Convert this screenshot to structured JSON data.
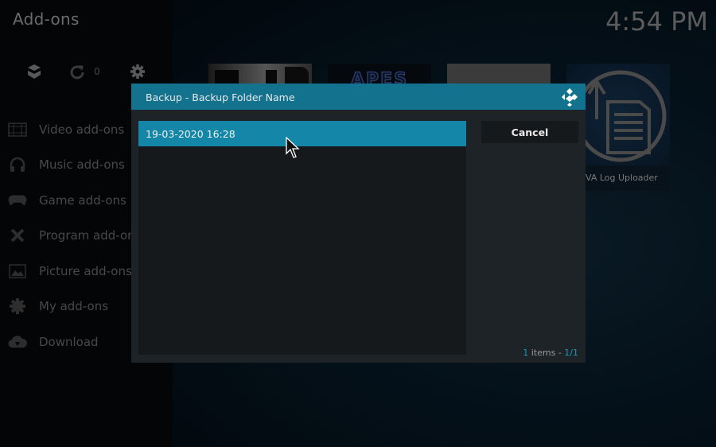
{
  "window": {
    "title": "Add-ons",
    "clock": "4:54 PM"
  },
  "toolbar": {
    "icons": [
      "box-icon",
      "refresh-icon",
      "gear-icon"
    ],
    "update_count": "0"
  },
  "sidebar": {
    "items": [
      {
        "label": "Video add-ons",
        "icon": "film-icon"
      },
      {
        "label": "Music add-ons",
        "icon": "headphones-icon"
      },
      {
        "label": "Game add-ons",
        "icon": "gamepad-icon"
      },
      {
        "label": "Program add-ons",
        "icon": "tools-icon"
      },
      {
        "label": "Picture add-ons",
        "icon": "picture-icon"
      },
      {
        "label": "My add-ons",
        "icon": "gear-wrench-icon"
      },
      {
        "label": "Download",
        "icon": "cloud-download-icon"
      }
    ]
  },
  "background_tiles": [
    {
      "label": ""
    },
    {
      "label": "APES"
    },
    {
      "label": ""
    },
    {
      "label": "VA Log Uploader"
    }
  ],
  "dialog": {
    "title": "Backup - Backup Folder Name",
    "items": [
      {
        "label": "19-03-2020 16:28",
        "selected": true
      }
    ],
    "cancel_label": "Cancel",
    "footer": {
      "count": "1",
      "items_text": " items - ",
      "page": "1/1"
    },
    "accent_color": "#13738f",
    "selected_color": "#1487a8"
  }
}
